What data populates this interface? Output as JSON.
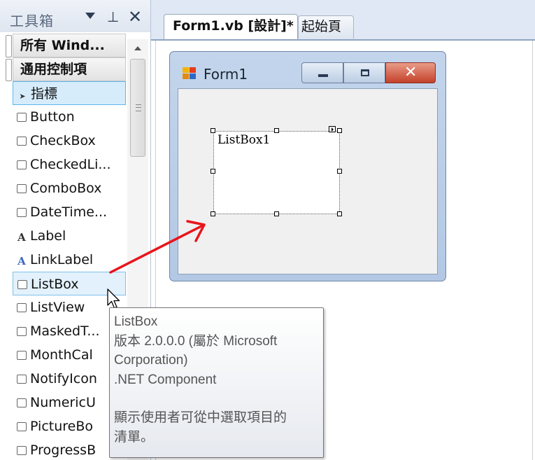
{
  "toolbox": {
    "title": "工具箱",
    "groups": [
      {
        "label": "所有 Wind..."
      },
      {
        "label": "通用控制項"
      }
    ],
    "items": [
      {
        "label": "指標",
        "icon": "pointer-arrow-icon"
      },
      {
        "label": "Button",
        "icon": "button-control-icon"
      },
      {
        "label": "CheckBox",
        "icon": "checkbox-control-icon"
      },
      {
        "label": "CheckedLi...",
        "icon": "checkedlistbox-control-icon"
      },
      {
        "label": "ComboBox",
        "icon": "combobox-control-icon"
      },
      {
        "label": "DateTime...",
        "icon": "datetimepicker-control-icon"
      },
      {
        "label": "Label",
        "icon": "label-control-icon",
        "glyph": "A"
      },
      {
        "label": "LinkLabel",
        "icon": "linklabel-control-icon",
        "glyph": "A"
      },
      {
        "label": "ListBox",
        "icon": "listbox-control-icon"
      },
      {
        "label": "ListView",
        "icon": "listview-control-icon"
      },
      {
        "label": "MaskedT...",
        "icon": "maskedtextbox-control-icon"
      },
      {
        "label": "MonthCal",
        "icon": "monthcalendar-control-icon"
      },
      {
        "label": "NotifyIcon",
        "icon": "notifyicon-control-icon"
      },
      {
        "label": "NumericU",
        "icon": "numericupdown-control-icon"
      },
      {
        "label": "PictureBo",
        "icon": "picturebox-control-icon"
      },
      {
        "label": "ProgressB",
        "icon": "progressbar-control-icon"
      }
    ]
  },
  "tabs": {
    "active": "Form1.vb [設計]*",
    "start": "起始頁"
  },
  "form": {
    "title": "Form1",
    "listbox_text": "ListBox1"
  },
  "tooltip": {
    "name": "ListBox",
    "version": "版本 2.0.0.0 (屬於 Microsoft",
    "version_cont": "Corporation)",
    "component": ".NET Component",
    "description": "顯示使用者可從中選取項目的",
    "description_cont": "清單。"
  },
  "colors": {
    "arrow": "#e8151b",
    "selection_border": "#5db6ec",
    "close_button": "#c4412a"
  }
}
